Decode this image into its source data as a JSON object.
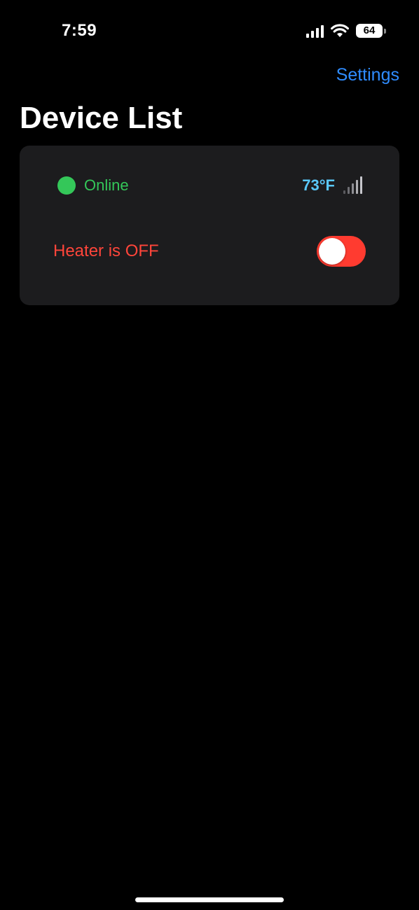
{
  "status_bar": {
    "time": "7:59",
    "cellular_icon": "cellular-signal-icon",
    "wifi_icon": "wifi-icon",
    "battery_icon": "battery-icon",
    "battery_level": "64"
  },
  "nav": {
    "settings_label": "Settings"
  },
  "page": {
    "title": "Device List"
  },
  "device": {
    "status_label": "Online",
    "status_color": "#34c759",
    "temperature": "73°F",
    "signal_icon": "signal-strength-icon",
    "heater_label": "Heater is OFF",
    "heater_on": false,
    "toggle_color": "#ff3b30"
  },
  "colors": {
    "background": "#000000",
    "card": "#1c1c1e",
    "accent": "#2f8cff",
    "temperature": "#5ac8fa",
    "heater_off": "#ff453a"
  }
}
